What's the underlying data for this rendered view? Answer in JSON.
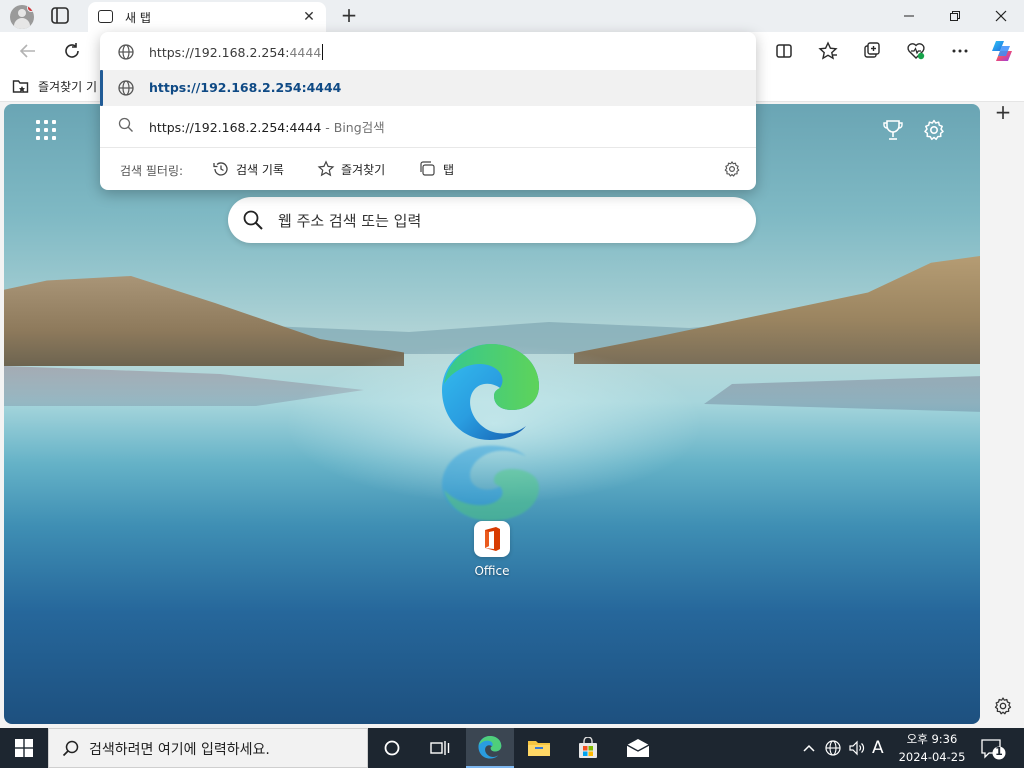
{
  "browser": {
    "tab_title": "새 탭",
    "favorites_bar_label": "즐겨찾기 기"
  },
  "omnibox": {
    "input_url": "https://192.168.2.254:",
    "input_port_hint": "4444",
    "suggestion_url": "https://192.168.2.254:4444",
    "suggestion_search_text": "https://192.168.2.254:4444",
    "suggestion_search_suffix": " - Bing검색",
    "filter_label": "검색 필터링:",
    "filters": [
      "검색 기록",
      "즐겨찾기",
      "탭"
    ]
  },
  "newtab": {
    "search_placeholder": "웹 주소 검색 또는 입력",
    "tiles": [
      {
        "label": "Office"
      }
    ]
  },
  "taskbar": {
    "search_placeholder": "검색하려면 여기에 입력하세요.",
    "ime": "A",
    "time": "오후 9:36",
    "date": "2024-04-25",
    "notification_count": "1"
  },
  "colors": {
    "accent": "#215b96",
    "suggestion_text": "#0f4a85",
    "taskbar_bg": "#1d2630"
  }
}
